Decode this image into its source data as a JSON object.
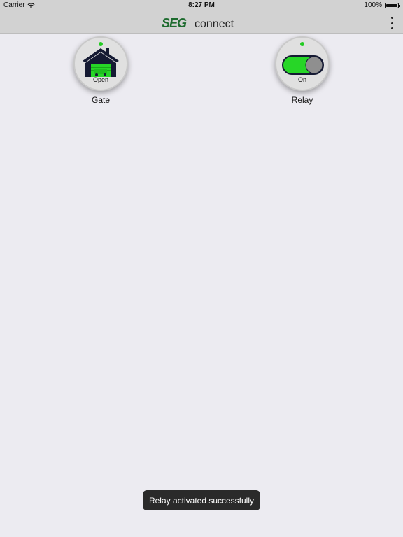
{
  "status_bar": {
    "carrier": "Carrier",
    "time": "8:27 PM",
    "battery": "100%"
  },
  "header": {
    "logo_seg": "SEG",
    "logo_connect": "connect"
  },
  "devices": [
    {
      "name": "Gate",
      "state": "Open",
      "icon": "garage-icon",
      "led_color": "#22cc22"
    },
    {
      "name": "Relay",
      "state": "On",
      "icon": "toggle-switch-icon",
      "led_color": "#22cc22"
    }
  ],
  "toast": {
    "message": "Relay activated successfully"
  },
  "colors": {
    "accent_green": "#22cc22",
    "logo_green": "#1d6b2e",
    "house_navy": "#151a33"
  }
}
